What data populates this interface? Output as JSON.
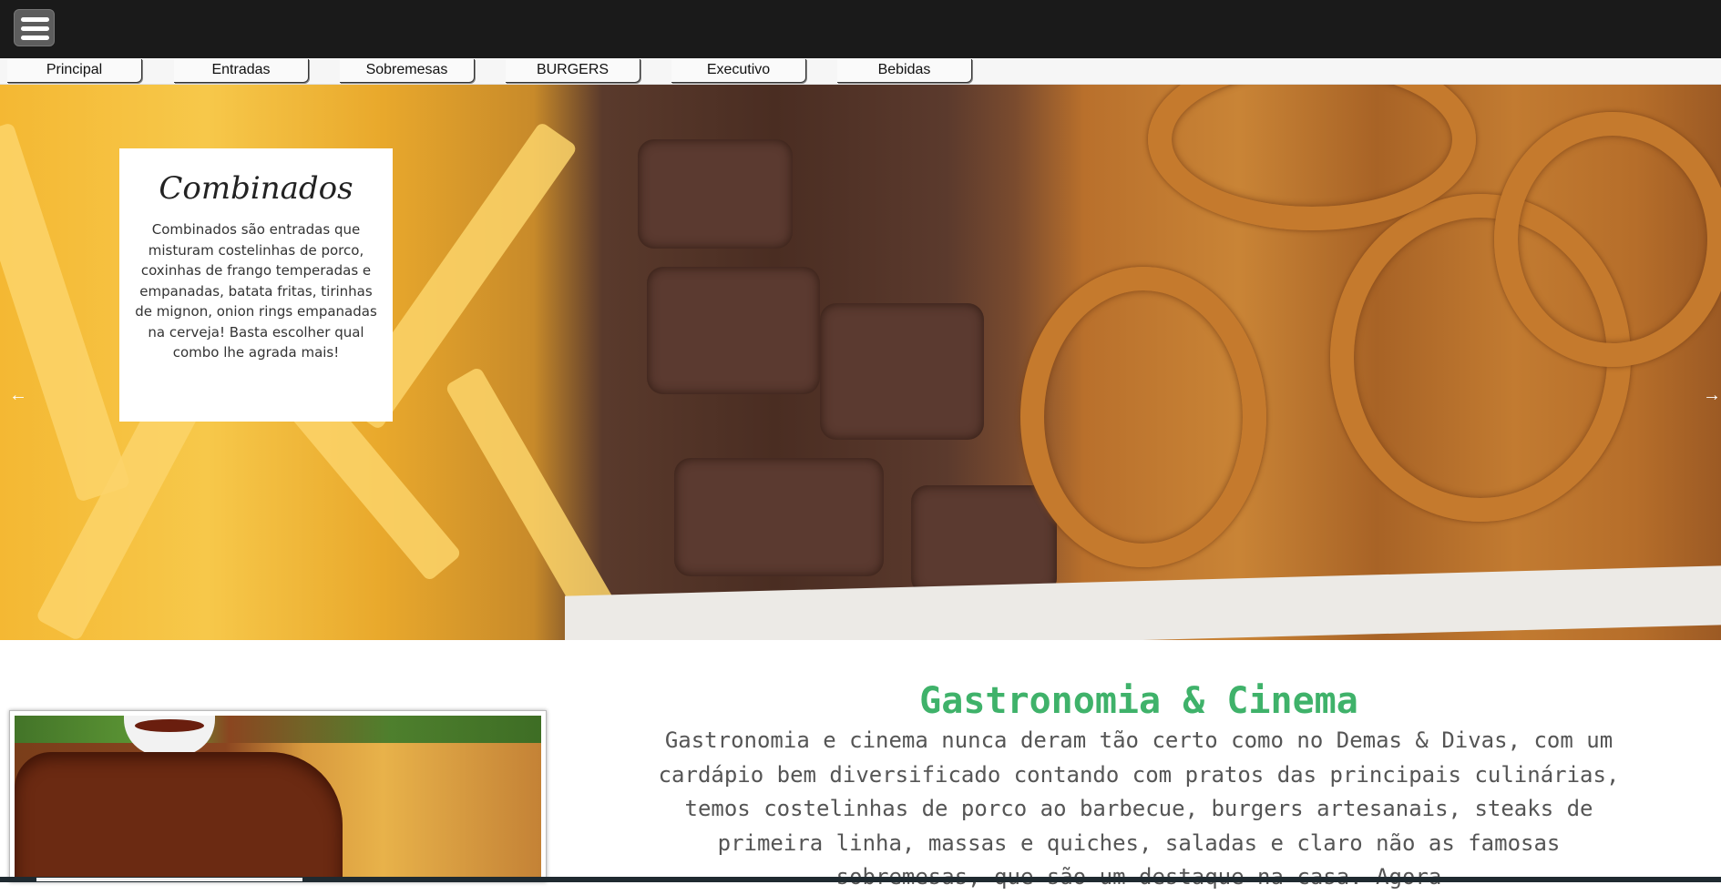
{
  "topbar": {
    "menu_icon": "hamburger-menu-icon"
  },
  "nav": {
    "tabs": [
      {
        "label": "Principal"
      },
      {
        "label": "Entradas"
      },
      {
        "label": "Sobremesas"
      },
      {
        "label": "BURGERS"
      },
      {
        "label": "Executivo"
      },
      {
        "label": "Bebidas"
      }
    ]
  },
  "hero": {
    "title": "Combinados",
    "text": "Combinados são entradas que misturam costelinhas de porco, coxinhas de frango temperadas e empanadas, batata fritas, tirinhas de mignon, onion rings empanadas na cerveja! Basta escolher qual combo lhe agrada mais!",
    "prev_arrow": "←",
    "next_arrow": "→"
  },
  "section": {
    "title": "Gastronomia & Cinema",
    "text": "Gastronomia e cinema nunca deram tão certo como no Demas & Divas, com um cardápio bem diversificado contando com pratos das principais culinárias, temos costelinhas de porco ao barbecue, burgers artesanais, steaks de primeira linha, massas e quiches, saladas e claro não as famosas sobremesas, que são um destaque na casa. Agora"
  },
  "colors": {
    "topbar": "#1a1a1a",
    "accent_green": "#3fb26a",
    "body_text": "#555555"
  }
}
